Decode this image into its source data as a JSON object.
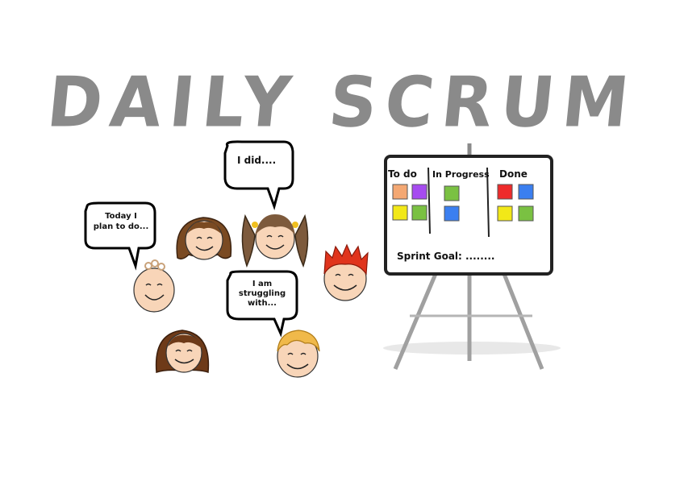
{
  "title": "DAILY SCRUM",
  "bubbles": {
    "did": "I did....",
    "plan_line1": "Today I",
    "plan_line2": "plan to do...",
    "struggle_line1": "I am",
    "struggle_line2": "struggling",
    "struggle_line3": "with..."
  },
  "board": {
    "columns": [
      "To do",
      "In Progress",
      "Done"
    ],
    "sprint_goal": "Sprint Goal: ........",
    "sticky_colors": {
      "todo": [
        "#f4a873",
        "#a64bf0",
        "#f2e818",
        "#7ac142"
      ],
      "in_progress": [
        "#7ac142",
        "#3b7ff0"
      ],
      "done": [
        "#ee2b2b",
        "#3b7ff0",
        "#f2e818",
        "#7ac142"
      ]
    }
  },
  "colors": {
    "title": "#8a8a8a",
    "skin": "#f8d5b8",
    "hair_brown": "#7a4a22",
    "hair_red": "#e0341c",
    "hair_blond": "#f0b94a"
  }
}
